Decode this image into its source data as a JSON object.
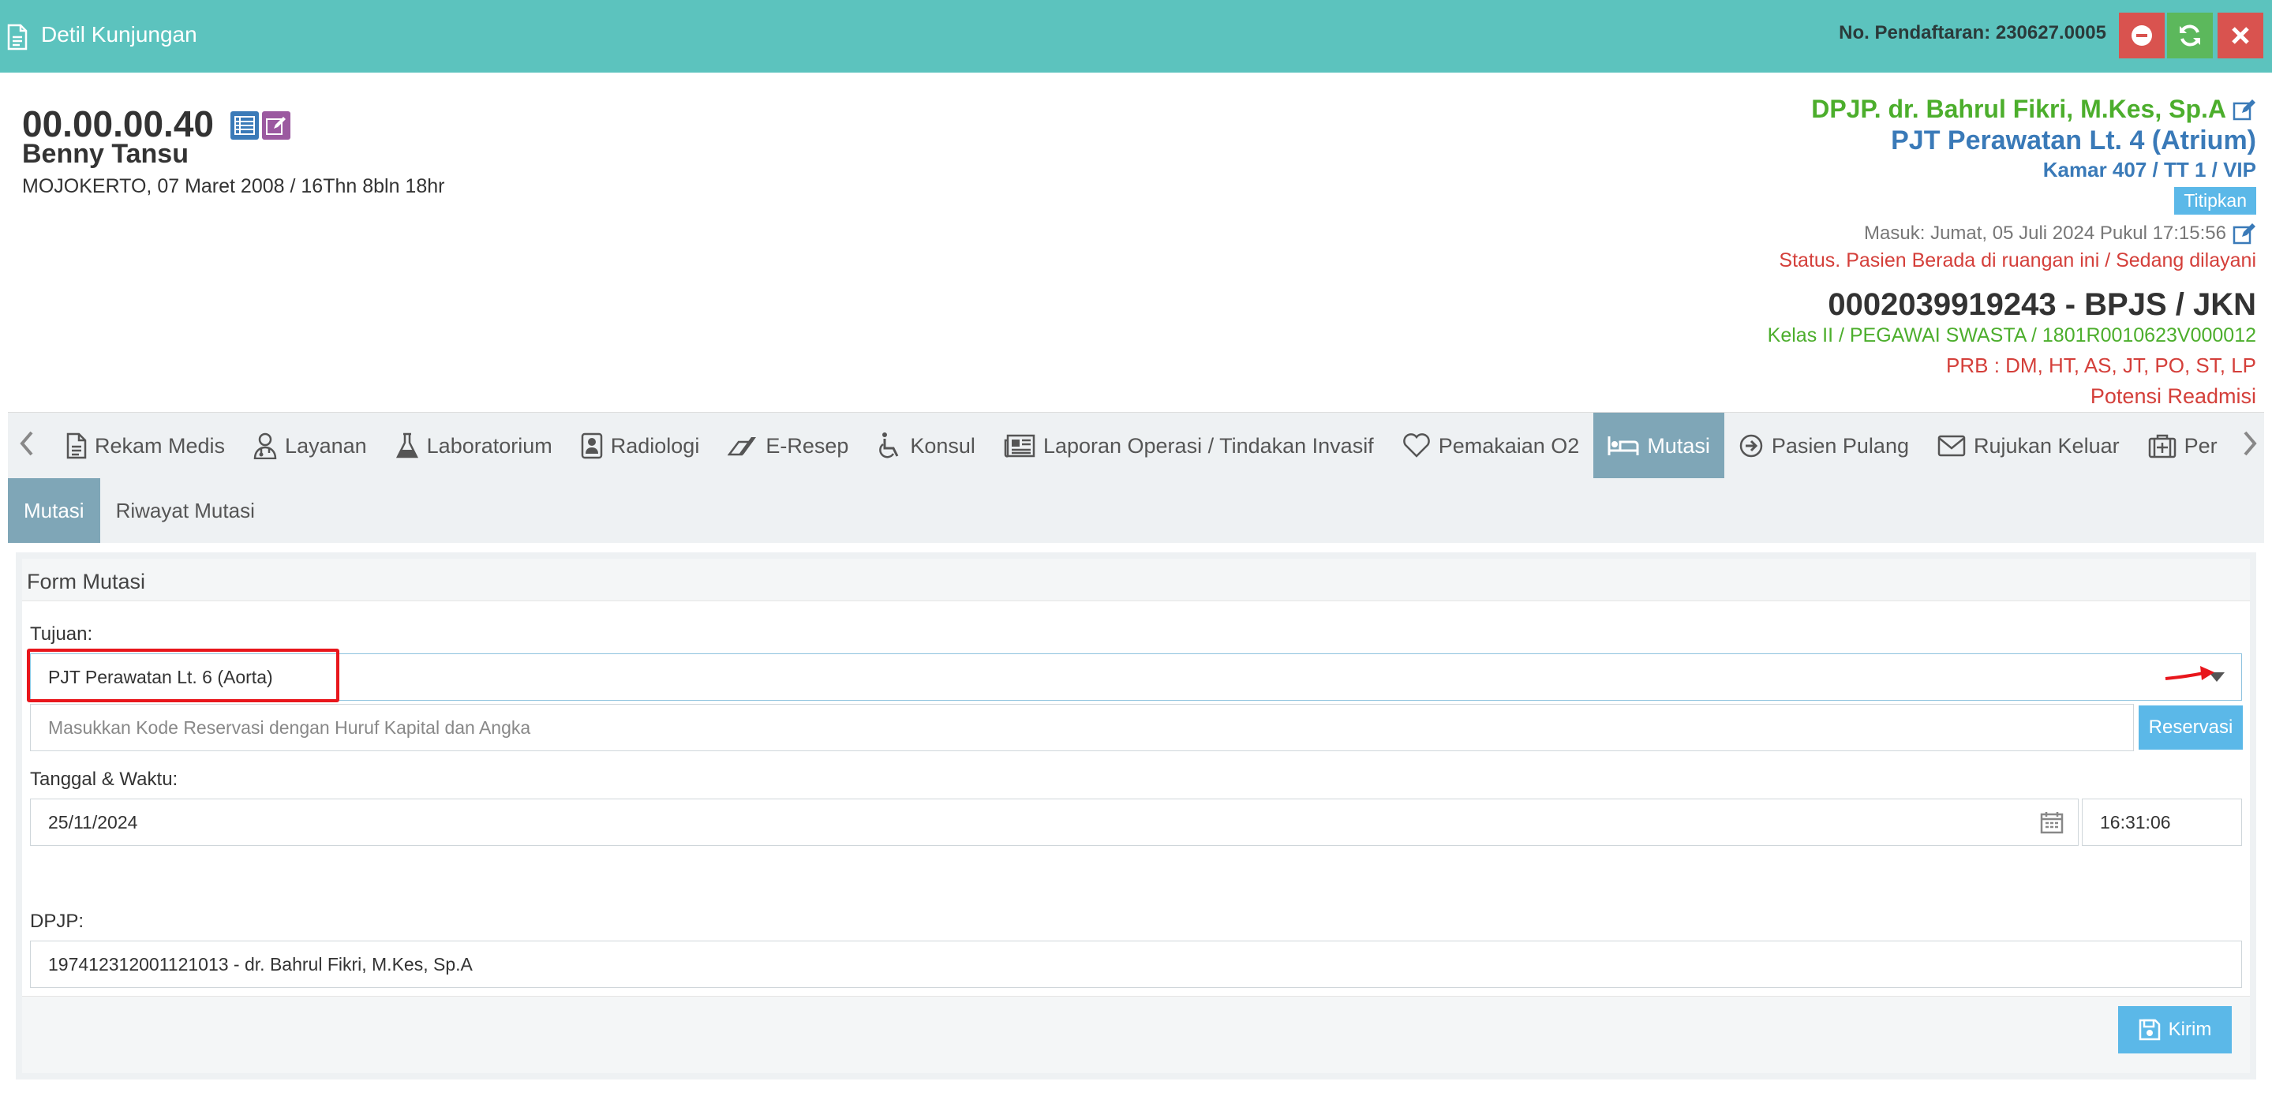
{
  "header": {
    "title": "Detil Kunjungan",
    "registration": "No. Pendaftaran: 230627.0005",
    "colors": {
      "bar": "#5cc3be",
      "danger": "#d9534f",
      "success": "#5cb85c"
    }
  },
  "patient": {
    "id": "00.00.00.40",
    "name": "Benny Tansu",
    "birth": "MOJOKERTO, 07 Maret 2008 / 16Thn 8bln 18hr"
  },
  "visit": {
    "dpjp": "DPJP. dr. Bahrul Fikri, M.Kes, Sp.A",
    "room": "PJT Perawatan Lt. 4 (Atrium)",
    "bed": "Kamar 407 / TT 1 / VIP",
    "titipkan": "Titipkan",
    "masuk": "Masuk: Jumat, 05 Juli 2024 Pukul 17:15:56",
    "status": "Status. Pasien Berada di ruangan ini / Sedang dilayani"
  },
  "insurance": {
    "number": "0002039919243 - BPJS / JKN",
    "kelas": "Kelas II / PEGAWAI SWASTA / 1801R0010623V000012",
    "prb": "PRB : DM, HT, AS, JT, PO, ST, LP",
    "readmisi": "Potensi Readmisi"
  },
  "tabs": [
    {
      "label": "Rekam Medis",
      "icon": "file-icon"
    },
    {
      "label": "Layanan",
      "icon": "doctor-icon"
    },
    {
      "label": "Laboratorium",
      "icon": "flask-icon"
    },
    {
      "label": "Radiologi",
      "icon": "xray-icon"
    },
    {
      "label": "E-Resep",
      "icon": "eraser-icon"
    },
    {
      "label": "Konsul",
      "icon": "wheelchair-icon"
    },
    {
      "label": "Laporan Operasi / Tindakan Invasif",
      "icon": "newspaper-icon"
    },
    {
      "label": "Pemakaian O2",
      "icon": "heart-icon"
    },
    {
      "label": "Mutasi",
      "icon": "bed-icon",
      "active": true
    },
    {
      "label": "Pasien Pulang",
      "icon": "arrow-circle-icon"
    },
    {
      "label": "Rujukan Keluar",
      "icon": "envelope-icon"
    },
    {
      "label": "Per",
      "icon": "medkit-icon"
    }
  ],
  "subtabs": [
    "Mutasi",
    "Riwayat Mutasi"
  ],
  "form": {
    "title": "Form Mutasi",
    "tujuan_label": "Tujuan:",
    "tujuan_value": "PJT Perawatan Lt. 6 (Aorta)",
    "reservasi_placeholder": "Masukkan Kode Reservasi dengan Huruf Kapital dan Angka",
    "reservasi_button": "Reservasi",
    "tanggal_label": "Tanggal & Waktu:",
    "tanggal_value": "25/11/2024",
    "waktu_value": "16:31:06",
    "dpjp_label": "DPJP:",
    "dpjp_value": "197412312001121013 - dr. Bahrul Fikri, M.Kes, Sp.A",
    "submit_button": "Kirim"
  }
}
